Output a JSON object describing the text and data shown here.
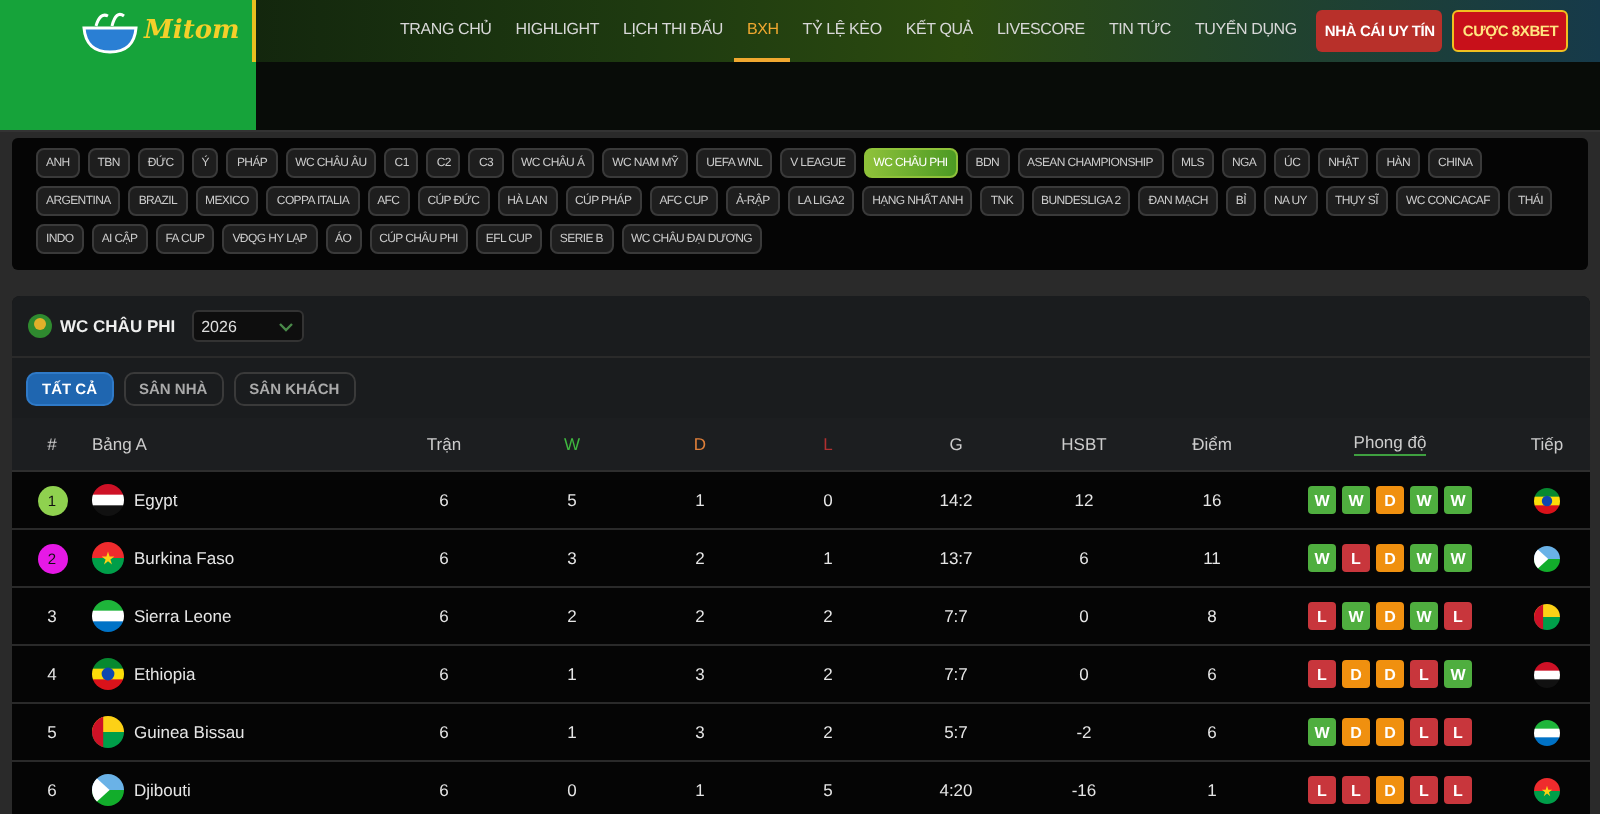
{
  "logo": {
    "text": "Mitom"
  },
  "nav": [
    {
      "label": "TRANG CHỦ",
      "selected": false
    },
    {
      "label": "HIGHLIGHT",
      "selected": false
    },
    {
      "label": "LỊCH THI ĐẤU",
      "selected": false
    },
    {
      "label": "BXH",
      "selected": true
    },
    {
      "label": "TỶ LỆ KÈO",
      "selected": false
    },
    {
      "label": "KẾT QUẢ",
      "selected": false
    },
    {
      "label": "LIVESCORE",
      "selected": false
    },
    {
      "label": "TIN TỨC",
      "selected": false
    },
    {
      "label": "TUYỂN DỤNG",
      "selected": false
    }
  ],
  "header_buttons": [
    {
      "label": "NHÀ CÁI UY TÍN",
      "kind": "red"
    },
    {
      "label": "CƯỢC 8XBET",
      "kind": "highlight"
    }
  ],
  "leagues": [
    {
      "label": "ANH",
      "selected": false
    },
    {
      "label": "TBN",
      "selected": false
    },
    {
      "label": "ĐỨC",
      "selected": false
    },
    {
      "label": "Ý",
      "selected": false
    },
    {
      "label": "PHÁP",
      "selected": false
    },
    {
      "label": "WC CHÂU ÂU",
      "selected": false
    },
    {
      "label": "C1",
      "selected": false
    },
    {
      "label": "C2",
      "selected": false
    },
    {
      "label": "C3",
      "selected": false
    },
    {
      "label": "WC CHÂU Á",
      "selected": false
    },
    {
      "label": "WC NAM MỸ",
      "selected": false
    },
    {
      "label": "UEFA WNL",
      "selected": false
    },
    {
      "label": "V LEAGUE",
      "selected": false
    },
    {
      "label": "WC CHÂU PHI",
      "selected": true
    },
    {
      "label": "BDN",
      "selected": false
    },
    {
      "label": "ASEAN CHAMPIONSHIP",
      "selected": false
    },
    {
      "label": "MLS",
      "selected": false
    },
    {
      "label": "NGA",
      "selected": false
    },
    {
      "label": "ÚC",
      "selected": false
    },
    {
      "label": "NHẬT",
      "selected": false
    },
    {
      "label": "HÀN",
      "selected": false
    },
    {
      "label": "CHINA",
      "selected": false
    },
    {
      "label": "ARGENTINA",
      "selected": false
    },
    {
      "label": "BRAZIL",
      "selected": false
    },
    {
      "label": "MEXICO",
      "selected": false
    },
    {
      "label": "COPPA ITALIA",
      "selected": false
    },
    {
      "label": "AFC",
      "selected": false
    },
    {
      "label": "CÚP ĐỨC",
      "selected": false
    },
    {
      "label": "HÀ LAN",
      "selected": false
    },
    {
      "label": "CÚP PHÁP",
      "selected": false
    },
    {
      "label": "AFC CUP",
      "selected": false
    },
    {
      "label": "Ả-RẬP",
      "selected": false
    },
    {
      "label": "LA LIGA2",
      "selected": false
    },
    {
      "label": "HẠNG NHẤT ANH",
      "selected": false
    },
    {
      "label": "TNK",
      "selected": false
    },
    {
      "label": "BUNDESLIGA 2",
      "selected": false
    },
    {
      "label": "ĐAN MẠCH",
      "selected": false
    },
    {
      "label": "BỈ",
      "selected": false
    },
    {
      "label": "NA UY",
      "selected": false
    },
    {
      "label": "THỤY SĨ",
      "selected": false
    },
    {
      "label": "WC CONCACAF",
      "selected": false
    },
    {
      "label": "THÁI",
      "selected": false
    },
    {
      "label": "INDO",
      "selected": false
    },
    {
      "label": "AI CẬP",
      "selected": false
    },
    {
      "label": "FA CUP",
      "selected": false
    },
    {
      "label": "VĐQG HY LẠP",
      "selected": false
    },
    {
      "label": "ÁO",
      "selected": false
    },
    {
      "label": "CÚP CHÂU PHI",
      "selected": false
    },
    {
      "label": "EFL CUP",
      "selected": false
    },
    {
      "label": "SERIE B",
      "selected": false
    },
    {
      "label": "WC CHÂU ĐẠI DƯƠNG",
      "selected": false
    }
  ],
  "standings": {
    "title": "WC CHÂU PHI",
    "season": "2026",
    "filters": [
      {
        "label": "TẤT CẢ",
        "selected": true
      },
      {
        "label": "SÂN NHÀ",
        "selected": false
      },
      {
        "label": "SÂN KHÁCH",
        "selected": false
      }
    ],
    "columns": [
      "#",
      "Bảng A",
      "Trận",
      "W",
      "D",
      "L",
      "G",
      "HSBT",
      "Điểm",
      "Phong độ",
      "Tiếp"
    ],
    "rows": [
      {
        "rank": "1",
        "color": "#8fd14f",
        "team": "Egypt",
        "played": "6",
        "w": "5",
        "d": "1",
        "l": "0",
        "g": "14:2",
        "hsbt": "12",
        "points": "16",
        "form": [
          "W",
          "W",
          "D",
          "W",
          "W"
        ]
      },
      {
        "rank": "2",
        "color": "#e619e6",
        "team": "Burkina Faso",
        "played": "6",
        "w": "3",
        "d": "2",
        "l": "1",
        "g": "13:7",
        "hsbt": "6",
        "points": "11",
        "form": [
          "W",
          "L",
          "D",
          "W",
          "W"
        ]
      },
      {
        "rank": "3",
        "team": "Sierra Leone",
        "played": "6",
        "w": "2",
        "d": "2",
        "l": "2",
        "g": "7:7",
        "hsbt": "0",
        "points": "8",
        "form": [
          "L",
          "W",
          "D",
          "W",
          "L"
        ]
      },
      {
        "rank": "4",
        "team": "Ethiopia",
        "played": "6",
        "w": "1",
        "d": "3",
        "l": "2",
        "g": "7:7",
        "hsbt": "0",
        "points": "6",
        "form": [
          "L",
          "D",
          "D",
          "L",
          "W"
        ]
      },
      {
        "rank": "5",
        "team": "Guinea Bissau",
        "played": "6",
        "w": "1",
        "d": "3",
        "l": "2",
        "g": "5:7",
        "hsbt": "-2",
        "points": "6",
        "form": [
          "W",
          "D",
          "D",
          "L",
          "L"
        ]
      },
      {
        "rank": "6",
        "team": "Djibouti",
        "played": "6",
        "w": "0",
        "d": "1",
        "l": "5",
        "g": "4:20",
        "hsbt": "-16",
        "points": "1",
        "form": [
          "L",
          "L",
          "D",
          "L",
          "L"
        ]
      }
    ]
  }
}
